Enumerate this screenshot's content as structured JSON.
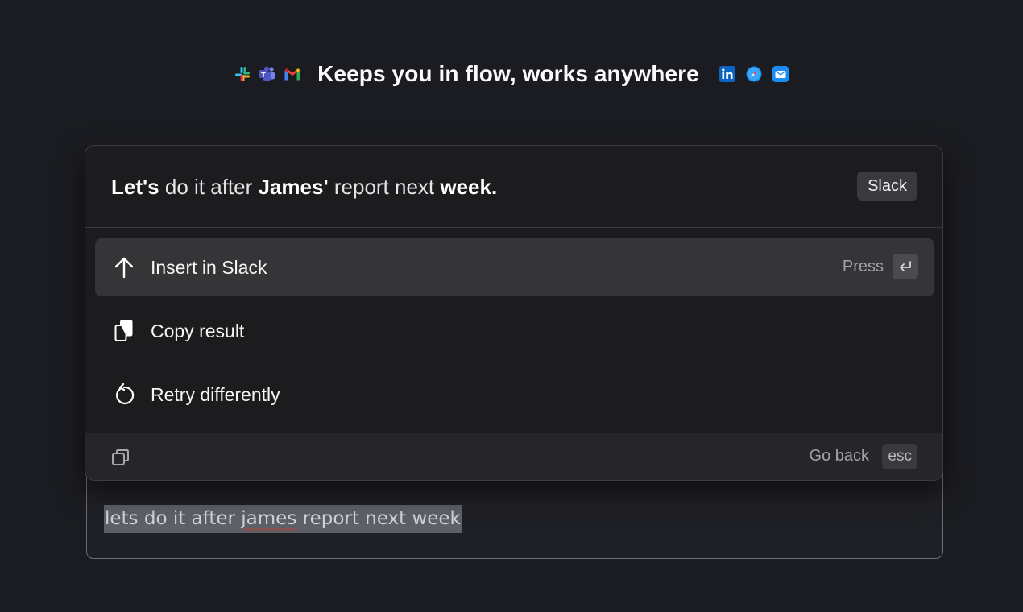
{
  "header": {
    "headline": "Keeps you in flow, works anywhere",
    "left_icons": [
      "slack-icon",
      "teams-icon",
      "gmail-icon"
    ],
    "right_icons": [
      "linkedin-icon",
      "safari-icon",
      "mail-icon"
    ]
  },
  "panel": {
    "suggestion_parts": [
      {
        "text": "Let's",
        "bold": true
      },
      {
        "text": " do it after ",
        "bold": false
      },
      {
        "text": "James'",
        "bold": true
      },
      {
        "text": " report next ",
        "bold": false
      },
      {
        "text": "week.",
        "bold": true
      }
    ],
    "app_badge": "Slack",
    "menu": [
      {
        "label": "Insert in Slack",
        "icon": "arrow-up-icon",
        "active": true
      },
      {
        "label": "Copy result",
        "icon": "copy-icon",
        "active": false
      },
      {
        "label": "Retry differently",
        "icon": "retry-icon",
        "active": false
      }
    ],
    "press_label": "Press",
    "enter_key_icon": "return-key-icon",
    "footer": {
      "icon": "panel-toggle-icon",
      "go_back_label": "Go back",
      "esc_label": "esc"
    }
  },
  "editor": {
    "text_before": "lets do it after ",
    "text_misspelled": "james",
    "text_after": " report next week"
  },
  "colors": {
    "background": "#1b1c21",
    "panel": "#1c1c1e",
    "active_row": "#353538",
    "selection": "#5e6068"
  }
}
